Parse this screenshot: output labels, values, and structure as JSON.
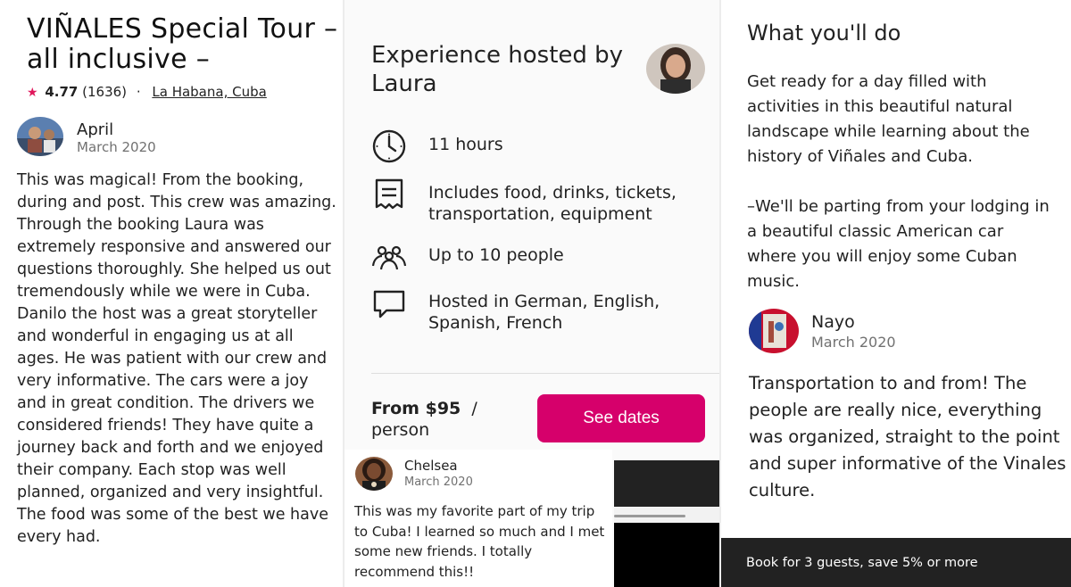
{
  "panel1": {
    "title": "VIÑALES Special Tour – all inclusive –",
    "rating": "4.77",
    "rating_count": "(1636)",
    "separator": "·",
    "location": "La Habana, Cuba",
    "review": {
      "name": "April",
      "date": "March 2020",
      "text": "This was magical! From the booking, during and post. This crew was amazing. Through the booking Laura was extremely responsive and answered our questions thoroughly. She helped us out tremendously while we were in Cuba. Danilo the host was a great storyteller and wonderful in engaging us at all ages. He was patient with our crew and very informative. The cars were a joy and in great condition. The drivers we considered friends! They have quite a journey back and forth and we enjoyed their company. Each stop was well planned, organized and very insightful. The food was some of the best we have every had."
    }
  },
  "panel2": {
    "host_heading": "Experience hosted by Laura",
    "features": [
      {
        "icon": "clock-icon",
        "text": "11 hours"
      },
      {
        "icon": "receipt-icon",
        "text": "Includes food, drinks, tickets, transportation, equipment"
      },
      {
        "icon": "people-icon",
        "text": "Up to 10 people"
      },
      {
        "icon": "chat-bubble-icon",
        "text": "Hosted in German, English, Spanish, French"
      }
    ],
    "price_from": "From $95",
    "price_sep": "/",
    "price_unit": "person",
    "cta": "See dates",
    "review": {
      "name": "Chelsea",
      "date": "March 2020",
      "text": "This was my favorite part of my trip to Cuba! I learned so much and I met some new friends. I totally recommend this!!"
    }
  },
  "panel3": {
    "heading": "What you'll do",
    "para1": "Get ready for a day filled with activities in this beautiful natural landscape while learning about the history of Viñales and Cuba.",
    "para2": "–We'll be parting from your lodging in a beautiful classic American car where you will enjoy some Cuban music.",
    "review": {
      "name": "Nayo",
      "date": "March 2020",
      "text": "Transportation to and from! The people are really nice, everything was organized, straight to the point and super informative of the Vinales culture."
    },
    "bottom_banner": "Book for 3 guests, save 5% or more"
  },
  "colors": {
    "accent": "#d6006b",
    "star": "#e0175b",
    "muted_text": "#717171",
    "dark_bar": "#222222"
  }
}
